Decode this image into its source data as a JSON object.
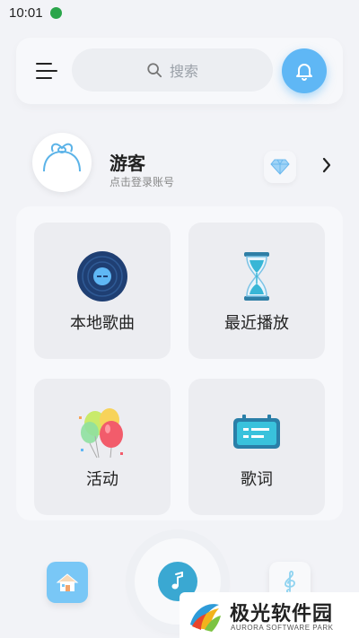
{
  "status_bar": {
    "time": "10:01",
    "app_icon": "app-notification-icon"
  },
  "header": {
    "menu_icon": "menu-icon",
    "search": {
      "placeholder": "搜索",
      "icon": "search-icon"
    },
    "bell_icon": "bell-icon",
    "accent": "#5fb7f5"
  },
  "profile": {
    "name": "游客",
    "subtitle": "点击登录账号",
    "vip_icon": "diamond-icon",
    "arrow_icon": "chevron-right-icon"
  },
  "grid": {
    "items": [
      {
        "label": "本地歌曲",
        "icon": "vinyl-record-icon"
      },
      {
        "label": "最近播放",
        "icon": "hourglass-icon"
      },
      {
        "label": "活动",
        "icon": "balloons-icon"
      },
      {
        "label": "歌词",
        "icon": "lyrics-card-icon"
      }
    ]
  },
  "bottom_nav": {
    "home_icon": "home-icon",
    "play_icon": "music-note-icon",
    "music_icon": "treble-clef-icon"
  },
  "watermark": {
    "title": "极光软件园",
    "subtitle": "AURORA SOFTWARE PARK"
  }
}
